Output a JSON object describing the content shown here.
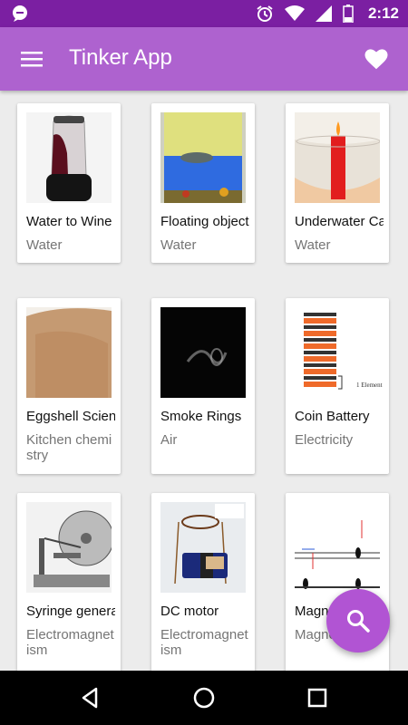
{
  "status_bar": {
    "time": "2:12",
    "icons": [
      "notification-bubble-icon",
      "alarm-icon",
      "wifi-icon",
      "battery-icon"
    ]
  },
  "app_bar": {
    "title": "Tinker App",
    "menu_icon": "hamburger-menu-icon",
    "favorite_icon": "heart-icon",
    "color": "#ae62cf"
  },
  "experiments": [
    {
      "name": "Water to Wine",
      "category": "Water"
    },
    {
      "name": "Floating objects",
      "category": "Water"
    },
    {
      "name": "Underwater Candle",
      "category": "Water"
    },
    {
      "name": "Eggshell Science",
      "category": "Kitchen chemistry"
    },
    {
      "name": "Smoke Rings",
      "category": "Air"
    },
    {
      "name": "Coin Battery",
      "category": "Electricity"
    },
    {
      "name": "Syringe generator",
      "category": "Electromagnetism"
    },
    {
      "name": "DC motor",
      "category": "Electromagnetism"
    },
    {
      "name": "Magnet",
      "category": "Magnetism"
    }
  ],
  "coin_battery_label": "1 Element",
  "fab": {
    "icon": "search-icon",
    "color": "#b154d3"
  },
  "nav_bar": {
    "icons": [
      "back-icon",
      "home-icon",
      "recents-icon"
    ]
  }
}
